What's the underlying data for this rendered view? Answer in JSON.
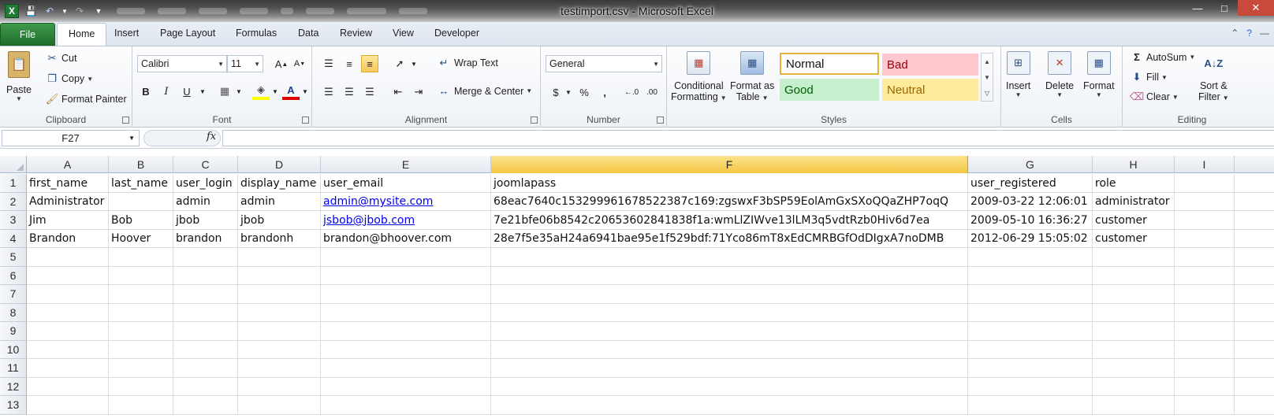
{
  "window": {
    "title": "testimport.csv  -  Microsoft Excel",
    "qat_blurred": [
      "Layout",
      "Type",
      "Select",
      "Filter",
      "3D",
      "View",
      "Window",
      "Help"
    ]
  },
  "tabs": [
    {
      "label": "File"
    },
    {
      "label": "Home"
    },
    {
      "label": "Insert"
    },
    {
      "label": "Page Layout"
    },
    {
      "label": "Formulas"
    },
    {
      "label": "Data"
    },
    {
      "label": "Review"
    },
    {
      "label": "View"
    },
    {
      "label": "Developer"
    }
  ],
  "ribbon": {
    "clipboard": {
      "label": "Clipboard",
      "paste": "Paste",
      "cut": "Cut",
      "copy": "Copy",
      "format_painter": "Format Painter"
    },
    "font": {
      "label": "Font",
      "name": "Calibri",
      "size": "11",
      "bold": "B",
      "italic": "I",
      "underline": "U"
    },
    "alignment": {
      "label": "Alignment",
      "wrap": "Wrap Text",
      "merge": "Merge & Center"
    },
    "number": {
      "label": "Number",
      "format": "General",
      "currency": "$",
      "percent": "%",
      "comma": ","
    },
    "styles": {
      "label": "Styles",
      "conditional": [
        "Conditional",
        "Formatting"
      ],
      "format_table": [
        "Format as",
        "Table"
      ],
      "normal": "Normal",
      "bad": "Bad",
      "good": "Good",
      "neutral": "Neutral",
      "colors": {
        "normal_bg": "#ffffff",
        "bad_bg": "#ffc7ce",
        "bad_fg": "#9c0006",
        "good_bg": "#c6efce",
        "good_fg": "#006100",
        "neutral_bg": "#ffeb9c",
        "neutral_fg": "#9c6500"
      }
    },
    "cells": {
      "label": "Cells",
      "insert": "Insert",
      "delete": "Delete",
      "format": "Format"
    },
    "editing": {
      "label": "Editing",
      "autosum": "AutoSum",
      "fill": "Fill",
      "clear": "Clear",
      "sort": [
        "Sort &",
        "Filter"
      ]
    }
  },
  "formula_bar": {
    "name_box": "F27",
    "fx": "fx",
    "value": ""
  },
  "grid": {
    "columns": [
      "A",
      "B",
      "C",
      "D",
      "E",
      "F",
      "G",
      "H",
      "I"
    ],
    "selected_column": "F",
    "row_numbers": [
      "1",
      "2",
      "3",
      "4",
      "5",
      "6",
      "7",
      "8",
      "9",
      "10",
      "11",
      "12",
      "13"
    ],
    "rows": [
      [
        "first_name",
        "last_name",
        "user_login",
        "display_name",
        "user_email",
        "joomlapass",
        "user_registered",
        "role"
      ],
      [
        "Administrator",
        "",
        "admin",
        "admin",
        "admin@mysite.com",
        "68eac7640c153299961678522387c169:zgswxF3bSP59EolAmGxSXoQQaZHP7oqQ",
        "2009-03-22 12:06:01",
        "administrator"
      ],
      [
        "Jim",
        "Bob",
        "jbob",
        "jbob",
        "jsbob@jbob.com",
        "7e21bfe06b8542c20653602841838f1a:wmLlZIWve13lLM3q5vdtRzb0Hiv6d7ea",
        "2009-05-10 16:36:27",
        "customer"
      ],
      [
        "Brandon",
        "Hoover",
        "brandon",
        "brandonh",
        "brandon@bhoover.com",
        "28e7f5e35aH24a6941bae95e1f529bdf:71Yco86mT8xEdCMRBGfOdDIgxA7noDMB",
        "2012-06-29 15:05:02",
        "customer"
      ]
    ],
    "hyperlink_cells": [
      "E2",
      "E3"
    ],
    "link_color": "#0000ee"
  }
}
